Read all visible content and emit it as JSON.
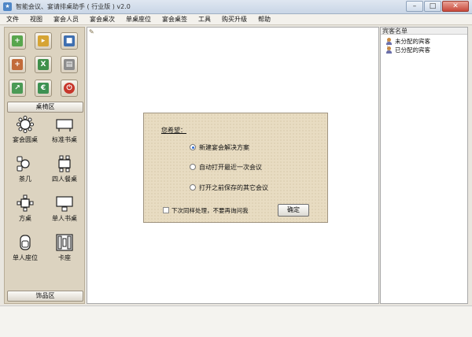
{
  "window": {
    "title": "智能会议、宴请排桌助手 ( 行业版 ) v2.0",
    "app_icon_glyph": "★",
    "minimize_glyph": "–",
    "maximize_glyph": "□",
    "close_glyph": "✕"
  },
  "menu": [
    "文件",
    "视图",
    "宴会人员",
    "宴会桌次",
    "单桌座位",
    "宴会桌签",
    "工具",
    "购买升级",
    "帮助"
  ],
  "toolbar": [
    {
      "icon": "new-plan-icon",
      "glyph": "+",
      "color": "#58a64d"
    },
    {
      "icon": "open-folder-icon",
      "glyph": "▸",
      "color": "#d6a433"
    },
    {
      "icon": "save-icon",
      "glyph": "■",
      "color": "#3f6fb0"
    },
    {
      "icon": "add-person-icon",
      "glyph": "+",
      "color": "#c26b3a"
    },
    {
      "icon": "excel-icon",
      "glyph": "X",
      "color": "#3f8f4a"
    },
    {
      "icon": "print-icon",
      "glyph": "▤",
      "color": "#8d8d8d"
    },
    {
      "icon": "export-icon",
      "glyph": "↗",
      "color": "#4b9a55"
    },
    {
      "icon": "currency-icon",
      "glyph": "€",
      "color": "#3d9152"
    },
    {
      "icon": "power-icon",
      "glyph": "⏻",
      "color": "#c7362b"
    }
  ],
  "sections": {
    "tables": "桌椅区",
    "decor": "饰品区"
  },
  "palette": [
    {
      "label": "宴会圆桌",
      "icon": "round-table-icon"
    },
    {
      "label": "标准书桌",
      "icon": "standard-desk-icon"
    },
    {
      "label": "茶几",
      "icon": "tea-table-icon"
    },
    {
      "label": "四人餐桌",
      "icon": "four-seat-table-icon"
    },
    {
      "label": "方桌",
      "icon": "square-table-icon"
    },
    {
      "label": "单人书桌",
      "icon": "single-desk-icon"
    },
    {
      "label": "单人座位",
      "icon": "single-seat-icon"
    },
    {
      "label": "卡座",
      "icon": "booth-icon"
    }
  ],
  "canvas": {
    "pin_glyph": "✎"
  },
  "guest_panel": {
    "header": "宾客名单",
    "nodes": [
      "未分配的宾客",
      "已分配的宾客"
    ]
  },
  "dialog": {
    "prompt": "您希望：",
    "options": [
      {
        "label": "新建宴会解决方案",
        "selected": true
      },
      {
        "label": "自动打开最近一次会议",
        "selected": false
      },
      {
        "label": "打开之前保存的其它会议",
        "selected": false
      }
    ],
    "remember_label": "下次同样处理，不要再询问我",
    "ok_label": "确定"
  }
}
